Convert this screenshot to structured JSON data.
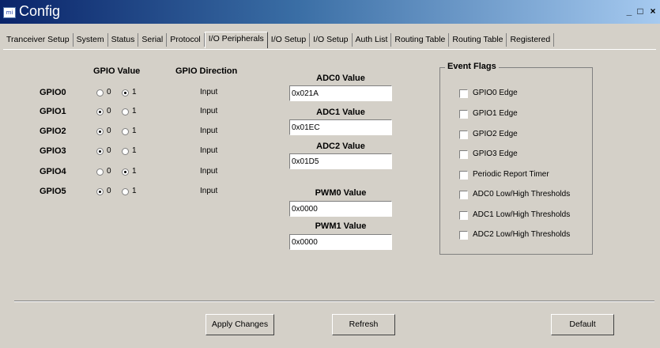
{
  "window": {
    "title": "Config",
    "icon_text": "mi",
    "min_label": "_",
    "max_label": "□",
    "close_label": "×"
  },
  "tabs": [
    {
      "label": "Tranceiver Setup"
    },
    {
      "label": "System"
    },
    {
      "label": "Status"
    },
    {
      "label": "Serial"
    },
    {
      "label": "Protocol"
    },
    {
      "label": "I/O Peripherals",
      "active": true
    },
    {
      "label": "I/O Setup"
    },
    {
      "label": "I/O Setup"
    },
    {
      "label": "Auth List"
    },
    {
      "label": "Routing Table"
    },
    {
      "label": "Routing Table"
    },
    {
      "label": "Registered"
    }
  ],
  "gpio": {
    "value_header": "GPIO Value",
    "direction_header": "GPIO Direction",
    "option0": "0",
    "option1": "1",
    "rows": [
      {
        "name": "GPIO0",
        "value": "1",
        "direction": "Input"
      },
      {
        "name": "GPIO1",
        "value": "0",
        "direction": "Input"
      },
      {
        "name": "GPIO2",
        "value": "0",
        "direction": "Input"
      },
      {
        "name": "GPIO3",
        "value": "0",
        "direction": "Input"
      },
      {
        "name": "GPIO4",
        "value": "1",
        "direction": "Input"
      },
      {
        "name": "GPIO5",
        "value": "0",
        "direction": "Input"
      }
    ]
  },
  "adc": [
    {
      "label": "ADC0 Value",
      "value": "0x021A"
    },
    {
      "label": "ADC1 Value",
      "value": "0x01EC"
    },
    {
      "label": "ADC2 Value",
      "value": "0x01D5"
    }
  ],
  "pwm": [
    {
      "label": "PWM0 Value",
      "value": "0x0000"
    },
    {
      "label": "PWM1 Value",
      "value": "0x0000"
    }
  ],
  "event_flags": {
    "title": "Event Flags",
    "items": [
      {
        "label": "GPIO0 Edge",
        "checked": false
      },
      {
        "label": "GPIO1 Edge",
        "checked": false
      },
      {
        "label": "GPIO2 Edge",
        "checked": false
      },
      {
        "label": "GPIO3 Edge",
        "checked": false
      },
      {
        "label": "Periodic Report Timer",
        "checked": false
      },
      {
        "label": "ADC0 Low/High Thresholds",
        "checked": false
      },
      {
        "label": "ADC1 Low/High Thresholds",
        "checked": false
      },
      {
        "label": "ADC2 Low/High Thresholds",
        "checked": false
      }
    ]
  },
  "buttons": {
    "apply": "Apply Changes",
    "refresh": "Refresh",
    "default": "Default"
  }
}
